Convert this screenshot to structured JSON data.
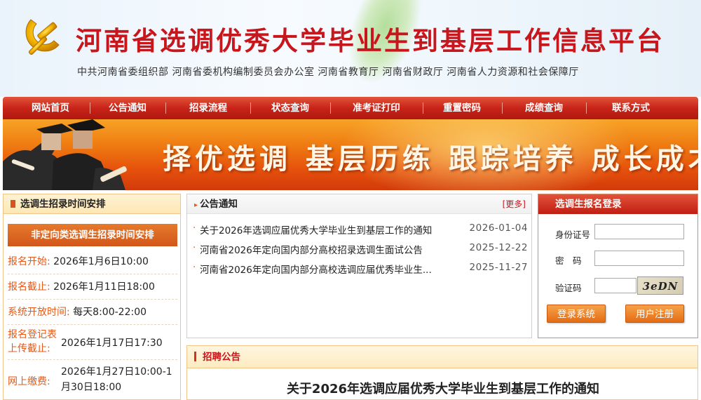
{
  "header": {
    "title": "河南省选调优秀大学毕业生到基层工作信息平台",
    "subtitle": "中共河南省委组织部  河南省委机构编制委员会办公室  河南省教育厅  河南省财政厅  河南省人力资源和社会保障厅",
    "emblem_icon": "party-emblem-icon",
    "brand_color": "#c8161d"
  },
  "nav": {
    "items": [
      "网站首页",
      "公告通知",
      "招录流程",
      "状态查询",
      "准考证打印",
      "重置密码",
      "成绩查询",
      "联系方式"
    ]
  },
  "banner": {
    "slogan": "择优选调  基层历练  跟踪培养  成长成才"
  },
  "schedule": {
    "title": "选调生招录时间安排",
    "subtitle": "非定向类选调生招录时间安排",
    "rows": [
      {
        "label": "报名开始:",
        "value": "2026年1月6日10:00"
      },
      {
        "label": "报名截止:",
        "value": "2026年1月11日18:00"
      },
      {
        "label": "系统开放时间:",
        "value": "每天8:00-22:00"
      },
      {
        "label": "报名登记表上传截止:",
        "label_line1": "报名登记表",
        "label_line2": "上传截止:",
        "value": "2026年1月17日17:30"
      },
      {
        "label": "网上缴费:",
        "value": "2026年1月27日10:00-1月30日18:00",
        "value_line1": "2026年1月27日10:00-1",
        "value_line2": "月30日18:00"
      }
    ]
  },
  "notice": {
    "title": "公告通知",
    "more": "[更多]",
    "items": [
      {
        "title": "关于2026年选调应届优秀大学毕业生到基层工作的通知",
        "date": "2026-01-04"
      },
      {
        "title": "河南省2026年定向国内部分高校招录选调生面试公告",
        "date": "2025-12-22"
      },
      {
        "title": "河南省2026年定向国内部分高校选调应届优秀毕业生...",
        "date": "2025-11-27"
      }
    ]
  },
  "login": {
    "title": "选调生报名登录",
    "id_label": "身份证号",
    "password_label": "密　码",
    "captcha_label": "验证码",
    "captcha_text": "3eDN",
    "login_button": "登录系统",
    "register_button": "用户注册",
    "id_value": "",
    "password_value": "",
    "captcha_value": ""
  },
  "recruit": {
    "title": "招聘公告",
    "headline": "关于2026年选调应届优秀大学毕业生到基层工作的通知"
  }
}
